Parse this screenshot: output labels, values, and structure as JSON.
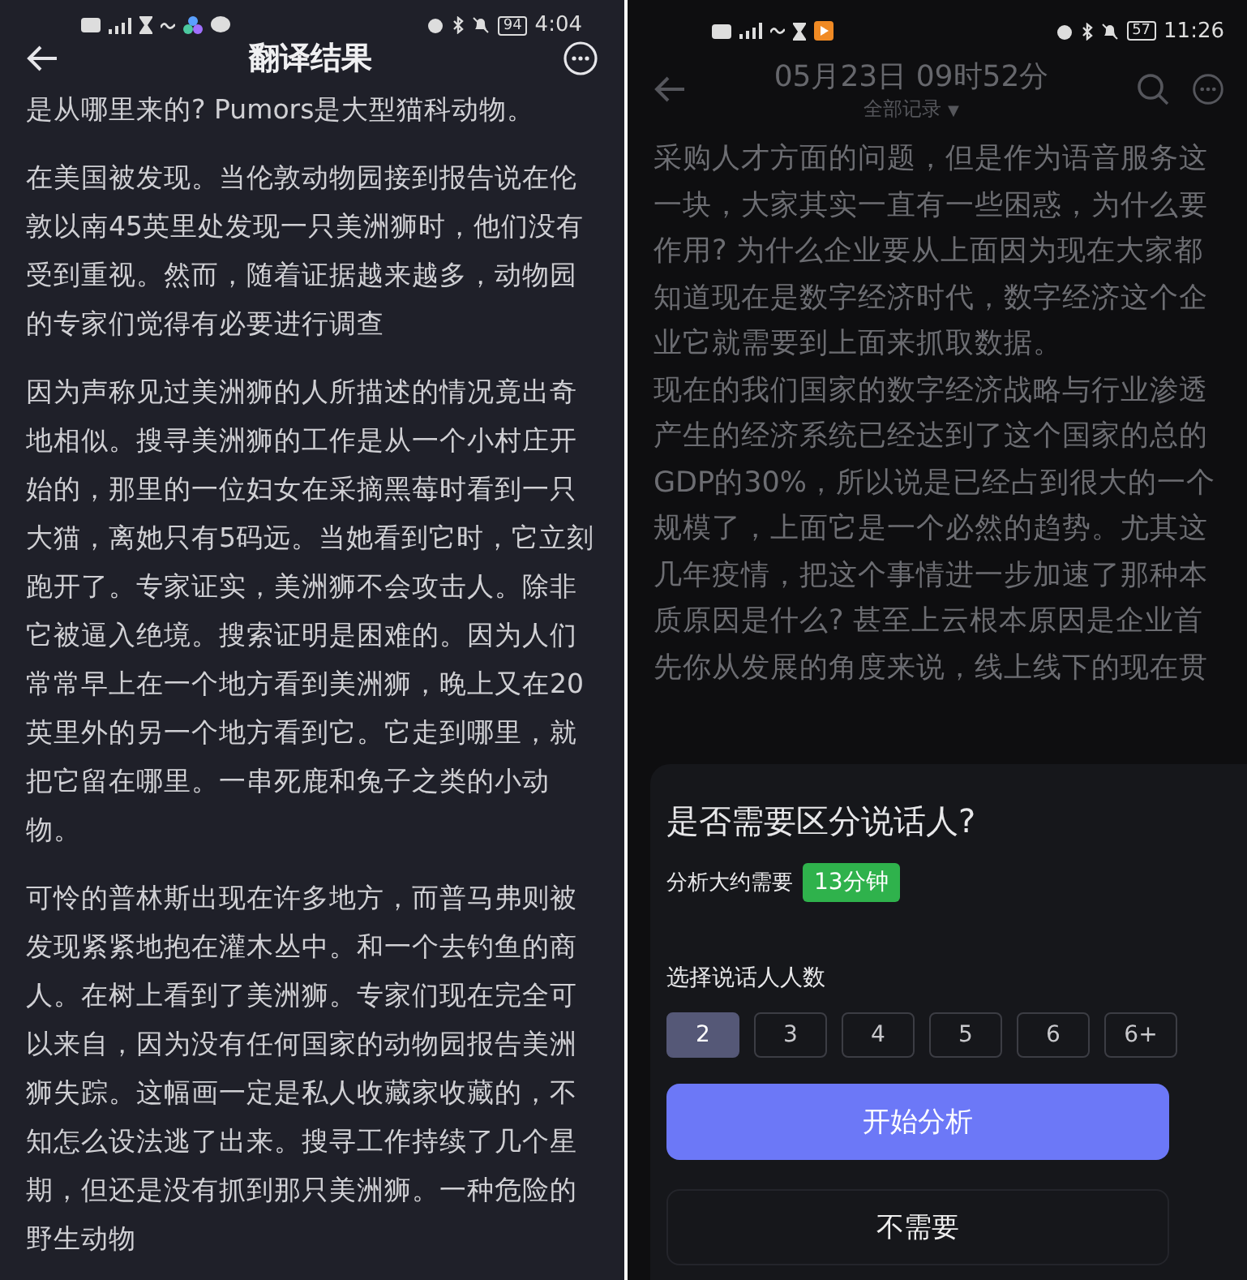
{
  "left_screen": {
    "status_bar": {
      "battery": "94",
      "time": "4:04"
    },
    "title": "翻译结果",
    "paragraphs": [
      "是从哪里来的? Pumors是大型猫科动物。",
      "在美国被发现。当伦敦动物园接到报告说在伦敦以南45英里处发现一只美洲狮时，他们没有受到重视。然而，随着证据越来越多，动物园的专家们觉得有必要进行调查",
      "因为声称见过美洲狮的人所描述的情况竟出奇地相似。搜寻美洲狮的工作是从一个小村庄开始的，那里的一位妇女在采摘黑莓时看到一只大猫，离她只有5码远。当她看到它时，它立刻跑开了。专家证实，美洲狮不会攻击人。除非它被逼入绝境。搜索证明是困难的。因为人们常常早上在一个地方看到美洲狮，晚上又在20英里外的另一个地方看到它。它走到哪里，就把它留在哪里。一串死鹿和兔子之类的小动物。",
      "可怜的普林斯出现在许多地方，而普马弗则被发现紧紧地抱在灌木丛中。和一个去钓鱼的商人。在树上看到了美洲狮。专家们现在完全可以来自，因为没有任何国家的动物园报告美洲狮失踪。这幅画一定是私人收藏家收藏的，不知怎么设法逃了出来。搜寻工作持续了几个星期，但还是没有抓到那只美洲狮。一种危险的野生动物"
    ]
  },
  "right_screen": {
    "status_bar": {
      "battery": "57",
      "time": "11:26"
    },
    "title": "05月23日 09时52分",
    "filter": "全部记录",
    "filter_caret": "▼",
    "paragraphs": [
      "采购人才方面的问题，但是作为语音服务这一块，大家其实一直有一些困惑，为什么要作用? 为什么企业要从上面因为现在大家都知道现在是数字经济时代，数字经济这个企业它就需要到上面来抓取数据。",
      "现在的我们国家的数字经济战略与行业渗透产生的经济系统已经达到了这个国家的总的GDP的30%，所以说是已经占到很大的一个规模了，上面它是一个必然的趋势。尤其这几年疫情，把这个事情进一步加速了那种本质原因是什么? 甚至上云根本原因是企业首先你从发展的角度来说，线上线下的现在贯"
    ],
    "sheet": {
      "title": "是否需要区分说话人?",
      "estimate_label": "分析大约需要",
      "estimate": "13分钟",
      "speakers_label": "选择说话人人数",
      "speaker_options": [
        {
          "label": "2",
          "selected": true
        },
        {
          "label": "3",
          "selected": false
        },
        {
          "label": "4",
          "selected": false
        },
        {
          "label": "5",
          "selected": false
        },
        {
          "label": "6",
          "selected": false
        },
        {
          "label": "6+",
          "selected": false
        }
      ],
      "primary_button": "开始分析",
      "secondary_button": "不需要"
    }
  }
}
